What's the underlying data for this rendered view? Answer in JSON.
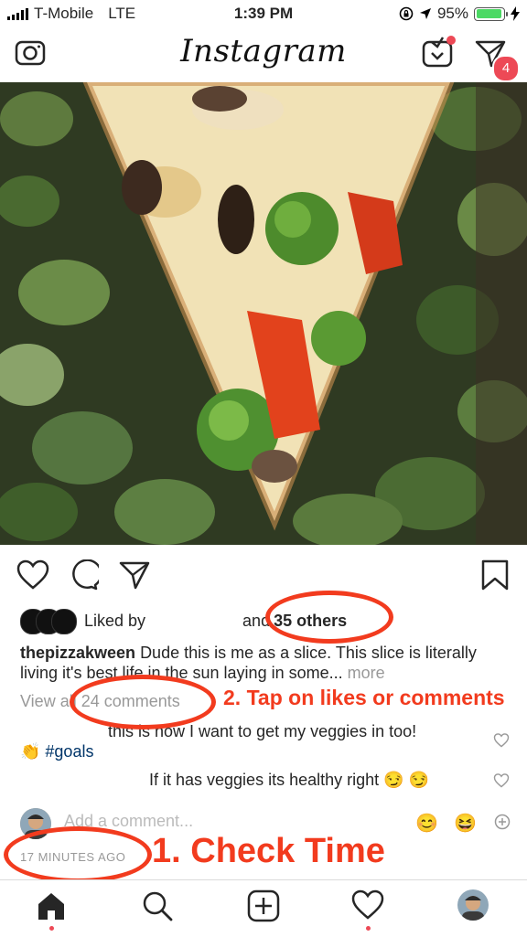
{
  "status": {
    "carrier": "T-Mobile",
    "network": "LTE",
    "time": "1:39 PM",
    "battery": "95%",
    "battery_level": 0.95,
    "battery_color": "#4cd964"
  },
  "header": {
    "logo": "Instagram",
    "dm_count": "4",
    "icons": [
      "camera-icon",
      "igtv-icon",
      "direct-message-icon"
    ]
  },
  "post": {
    "liked_by_prefix": "Liked by",
    "liked_by_and": "and",
    "liked_by_others": "35 others",
    "caption_user": "thepizzakween",
    "caption_text": "Dude this is me as a slice. This slice is literally living it's best life in the sun laying in some...",
    "caption_more": "more",
    "view_all": "View all 24 comments",
    "comments": [
      {
        "text": "this is how I want to get my veggies in too!"
      },
      {
        "text": "👏 #goals"
      },
      {
        "text": "If it has veggies its healthy right 😏 😏"
      }
    ],
    "add_comment_placeholder": "Add a comment...",
    "quick_emojis": [
      "😊",
      "😆"
    ],
    "time_ago": "17 MINUTES AGO"
  },
  "annotations": {
    "step1": "1. Check Time",
    "step2": "2. Tap on likes or comments",
    "color": "#f23b1e"
  },
  "tabs": [
    "home",
    "search",
    "add-post",
    "activity",
    "profile"
  ],
  "colors": {
    "badge": "#ed4956",
    "hashtag": "#003569",
    "muted": "#999999",
    "divider": "#dbdbdb"
  }
}
